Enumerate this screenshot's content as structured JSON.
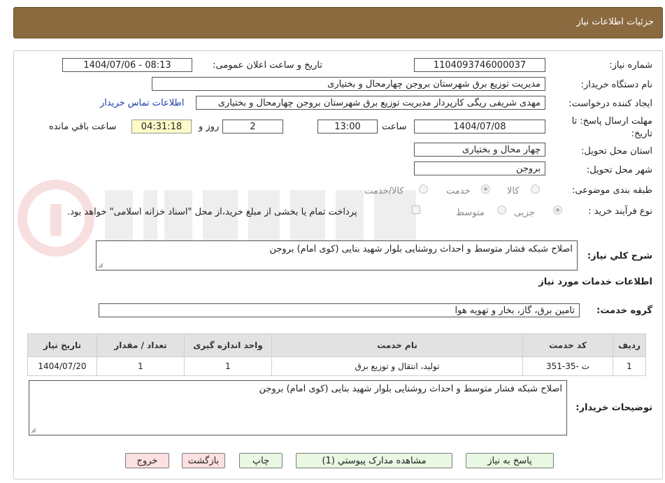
{
  "header": {
    "title": "جزئیات اطلاعات نیاز"
  },
  "form": {
    "need_number_label": "شماره نیاز:",
    "need_number": "1104093746000037",
    "announce_label": "تاریخ و ساعت اعلان عمومی:",
    "announce_value": "1404/07/06 - 08:13",
    "buyer_org_label": "نام دستگاه خریدار:",
    "buyer_org": "مدیریت توزیع برق شهرستان بروجن چهارمحال و بختیاری",
    "creator_label": "ایجاد کننده درخواست:",
    "creator": "مهدی شریفی ریگی کارپرداز مدیریت توزیع برق شهرستان بروجن چهارمحال و بختیاری",
    "contact_link": "اطلاعات تماس خریدار",
    "deadline_label_1": "مهلت ارسال پاسخ: تا",
    "deadline_label_2": "تاریخ:",
    "deadline_date": "1404/07/08",
    "time_label": "ساعت",
    "deadline_time": "13:00",
    "days_value": "2",
    "days_label": "روز و",
    "remaining_time": "04:31:18",
    "remaining_label": "ساعت باقي مانده",
    "province_label": "استان محل تحویل:",
    "province": "چهار محال و بختیاری",
    "city_label": "شهر محل تحویل:",
    "city": "بروجن",
    "category_label": "طبقه بندی موضوعی:",
    "category_options": [
      "کالا",
      "خدمت",
      "کالا/خدمت"
    ],
    "process_label": "نوع فرآیند خرید :",
    "process_options": [
      "جزیی",
      "متوسط"
    ],
    "payment_note": "پرداخت تمام یا بخشی از مبلغ خرید،از محل \"اسناد خزانه اسلامی\" خواهد بود.",
    "description_label": "شرح کلي نياز:",
    "description": "اصلاح شبکه فشار متوسط و احداث روشنایی بلوار شهید بنایی (کوی امام) بروجن",
    "services_heading": "اطلاعات خدمات مورد نیاز",
    "service_group_label": "گروه خدمت:",
    "service_group": "تامین برق، گاز، بخار و تهویه هوا",
    "buyer_notes_label": "توضیحات خریدار:",
    "buyer_notes": "اصلاح شبکه فشار متوسط و احداث روشنایی بلوار شهید بنایی (کوی امام) بروجن"
  },
  "table": {
    "headers": [
      "ردیف",
      "کد خدمت",
      "نام خدمت",
      "واحد اندازه گیری",
      "تعداد / مقدار",
      "تاریخ نیاز"
    ],
    "rows": [
      [
        "1",
        "ت -35-351",
        "تولید، انتقال و توزیع برق",
        "1",
        "1",
        "1404/07/20"
      ]
    ]
  },
  "buttons": {
    "reply": "پاسخ به نیاز",
    "attachments": "مشاهده مدارک پیوستي (1)",
    "print": "چاپ",
    "back": "بازگشت",
    "exit": "خروج"
  },
  "colors": {
    "header_bg": "#8b6a40",
    "button_green": "#e9f8e2",
    "button_pink": "#fde0e0",
    "link": "#1a3fa8",
    "remaining_bg": "#fffbc9"
  }
}
